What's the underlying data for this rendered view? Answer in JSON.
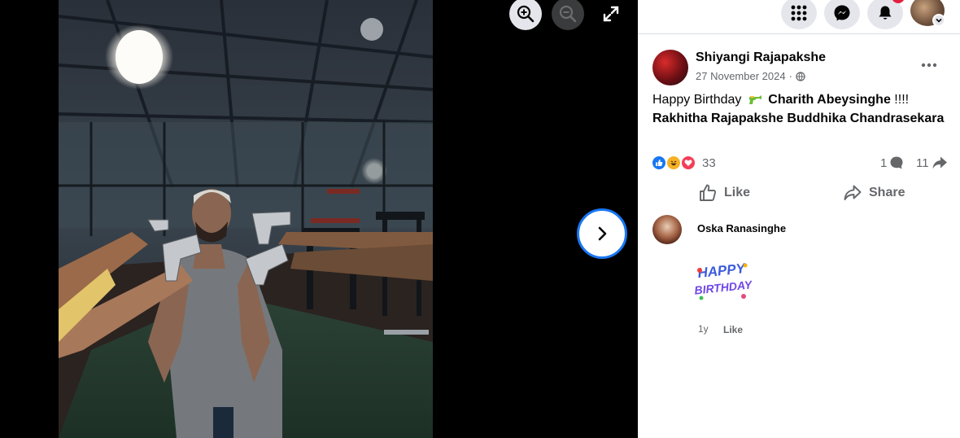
{
  "post": {
    "author": "Shiyangi Rajapakshe",
    "date": "27 November 2024",
    "separator": "·",
    "privacy_icon": "globe-icon",
    "text_prefix": "Happy Birthday",
    "emoji": "water-pistol",
    "tagged_first": "Charith Abeysinghe",
    "text_suffix": "!!!!",
    "tagged_line": "Rakhitha Rajapakshe Buddhika Chandrasekara"
  },
  "stats": {
    "reaction_count": "33",
    "reactions": [
      "like",
      "haha",
      "love"
    ],
    "comment_count": "1",
    "share_count": "11"
  },
  "actions": {
    "like_label": "Like",
    "share_label": "Share"
  },
  "comment": {
    "author": "Oska Ranasinghe",
    "sticker_text_1": "HAPPY",
    "sticker_text_2": "BIRTHDAY",
    "time": "1y",
    "like_label": "Like"
  },
  "colors": {
    "accent": "#1877f2",
    "notification_badge": "#e41e3f",
    "secondary_text": "#65676b"
  }
}
